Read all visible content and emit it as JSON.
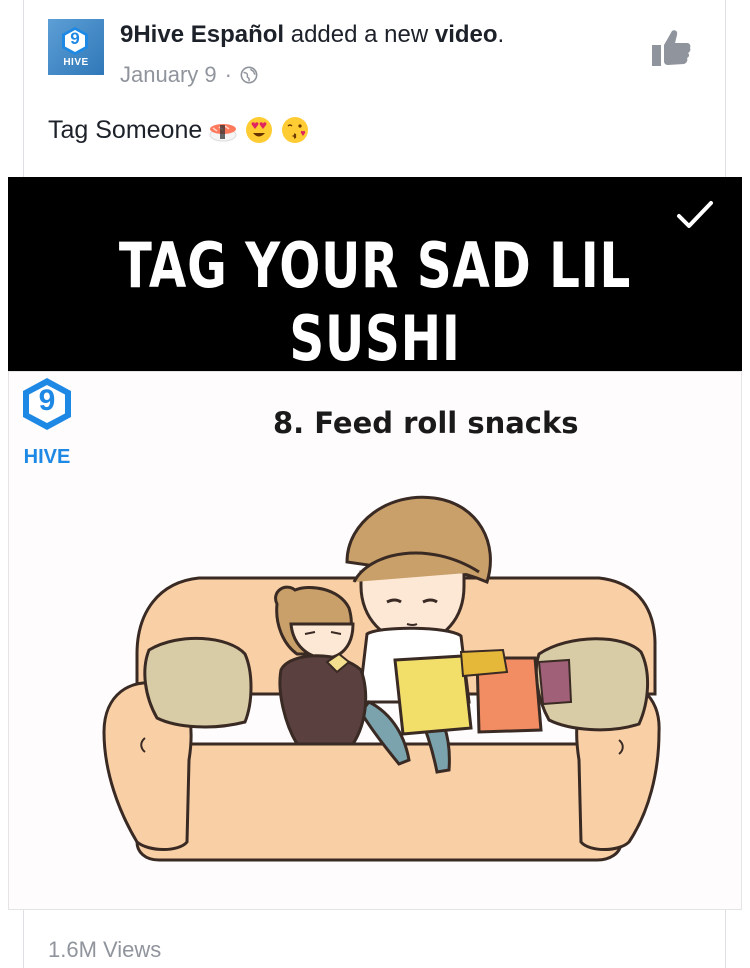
{
  "post": {
    "page_name": "9Hive Español",
    "action_text": " added a new ",
    "object": "video",
    "period": ".",
    "date": "January 9",
    "separator": "·",
    "privacy_icon": "globe-icon",
    "like_icon": "thumbs-up-icon",
    "message": "Tag Someone",
    "message_emojis": [
      "sushi",
      "heart-eyes",
      "kissing-face"
    ]
  },
  "avatar": {
    "number": "9",
    "label": "HIVE"
  },
  "video": {
    "banner_title": "TAG YOUR SAD LIL SUSHI",
    "check_icon": "checkmark-icon",
    "brand_number": "9",
    "brand_label": "HIVE",
    "caption": "8. Feed roll snacks",
    "illustration": "couch-illustration"
  },
  "stats": {
    "views": "1.6M Views"
  },
  "colors": {
    "brand_blue": "#1e88e5",
    "meta_gray": "#90949c",
    "banner_bg": "#000000"
  }
}
